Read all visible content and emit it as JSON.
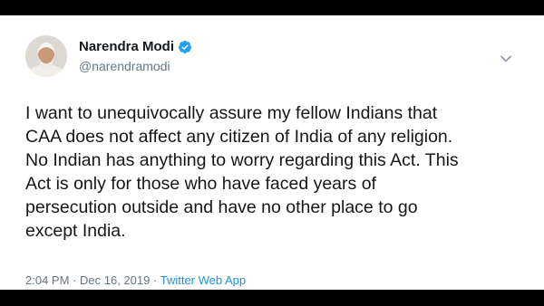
{
  "tweet": {
    "author": {
      "display_name": "Narendra Modi",
      "handle": "@narendramodi",
      "verified": true
    },
    "text_lines": [
      "I want to unequivocally assure my fellow Indians that",
      "CAA does not affect any citizen of India of any religion.",
      "No Indian has anything to worry regarding this Act. This",
      "Act is only for those who have faced years of",
      "persecution outside and have no other place to go",
      "except India."
    ],
    "meta": {
      "time": "2:04 PM",
      "separator1": "·",
      "date": "Dec 16, 2019",
      "separator2": "·",
      "source": "Twitter Web App"
    }
  },
  "colors": {
    "text": "#14171a",
    "muted": "#657786",
    "link": "#1b95e0",
    "verified_badge": "#1da1f2",
    "frame": "#000000"
  },
  "icons": {
    "verified": "verified-badge-icon",
    "menu": "chevron-down-icon"
  }
}
